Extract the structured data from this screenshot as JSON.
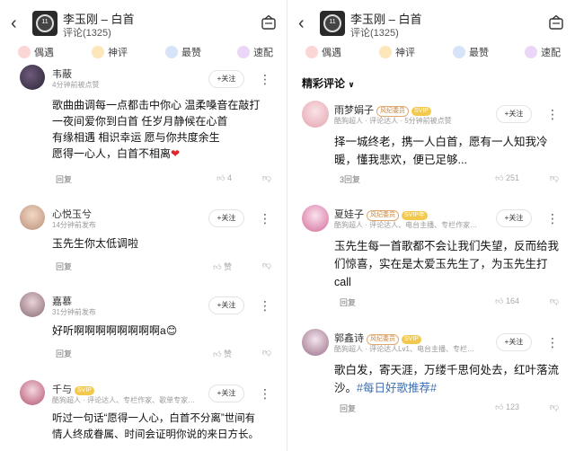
{
  "header": {
    "song_title": "李玉刚 – 白首",
    "comment_count": "评论(1325)",
    "cover_text": "11"
  },
  "tabs": [
    {
      "label": "偶遇",
      "icon": "people-meet-icon",
      "color": "#f08a8a"
    },
    {
      "label": "神评",
      "icon": "divine-comment-icon",
      "color": "#f5c06a"
    },
    {
      "label": "最赞",
      "icon": "thumb-up-icon",
      "color": "#7aa7e6"
    },
    {
      "label": "速配",
      "icon": "match-icon",
      "color": "#c48ae6"
    }
  ],
  "left": {
    "comments": [
      {
        "username": "韦蔽",
        "meta": "4分钟前被点赞",
        "follow": "+关注",
        "lines": [
          "歌曲曲调每一点都击中你心 温柔嗓音在敲打",
          "一夜间爱你到白首 任岁月静候在心首",
          "有缘相遇 相识幸运 愿与你共度余生",
          "愿得一心人，白首不相离"
        ],
        "heart": "❤",
        "reply": "回复",
        "likes": "4"
      },
      {
        "username": "心悦玉兮",
        "meta": "14分钟前发布",
        "follow": "+关注",
        "lines": [
          "玉先生你太低调啦"
        ],
        "reply": "回复",
        "likes": "赞"
      },
      {
        "username": "嘉慕",
        "meta": "31分钟前发布",
        "follow": "+关注",
        "lines": [
          "好听啊啊啊啊啊啊啊啊a"
        ],
        "emoji": "😊",
        "reply": "回复",
        "likes": "赞"
      },
      {
        "username": "千与",
        "badge_vip": "SVIP",
        "meta": "酷狗超人 · 评论达人、专栏作家、歌单专家…",
        "follow": "+关注",
        "lines": [
          "听过一句话“愿得一人心，白首不分离”世间有",
          "情人终成眷属、时间会证明你说的来日方长。"
        ]
      }
    ]
  },
  "right": {
    "section_title": "精彩评论",
    "comments": [
      {
        "username": "雨梦娟子",
        "badge_rec": "风纪委员",
        "badge_vip": "SVIP",
        "meta": "酷狗超人 · 评论达人 · 5分钟前被点赞",
        "follow": "+关注",
        "lines": [
          "择一城终老，携一人白首，愿有一人知我冷",
          "暖，懂我悲欢，便已足够..."
        ],
        "reply": "3回复",
        "likes": "251"
      },
      {
        "username": "夏娃子",
        "badge_rec": "风纪委员",
        "badge_vip": "SVIP年",
        "meta": "酷狗超人 · 评论达人、电台主播、专栏作家…",
        "follow": "+关注",
        "lines": [
          "玉先生每一首歌都不会让我们失望，反而给我",
          "们惊喜，实在是太爱玉先生了，为玉先生打",
          "call"
        ],
        "reply": "回复",
        "likes": "164"
      },
      {
        "username": "郭鑫诗",
        "badge_rec": "风纪委员",
        "badge_vip": "SVIP",
        "meta": "酷狗超人 · 评论达人Lv1、电台主播、专栏…",
        "follow": "+关注",
        "lines": [
          "歌白发，寄天涯，万缕千思何处去，红叶落流",
          "沙。"
        ],
        "hashtag": "#每日好歌推荐#",
        "reply": "回复",
        "likes": "123"
      }
    ]
  },
  "colors": {
    "accent_blue": "#3a6fb0",
    "vip_gold": "#f2c94c",
    "heart_red": "#e0262a"
  }
}
